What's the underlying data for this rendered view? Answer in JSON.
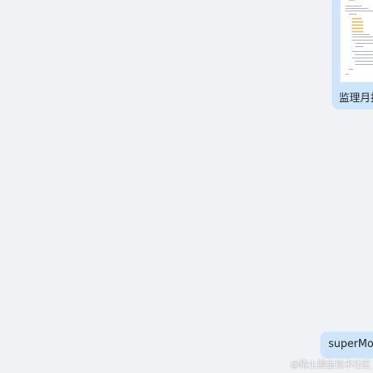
{
  "messages": [
    {
      "caption": "监理月报",
      "has_image": true
    },
    {
      "text": "superMon"
    }
  ],
  "watermark": "@稀土掘金技术社区",
  "colors": {
    "background": "#f0f2f5",
    "bubble": "#cfe5fb",
    "text": "#1f2329"
  }
}
